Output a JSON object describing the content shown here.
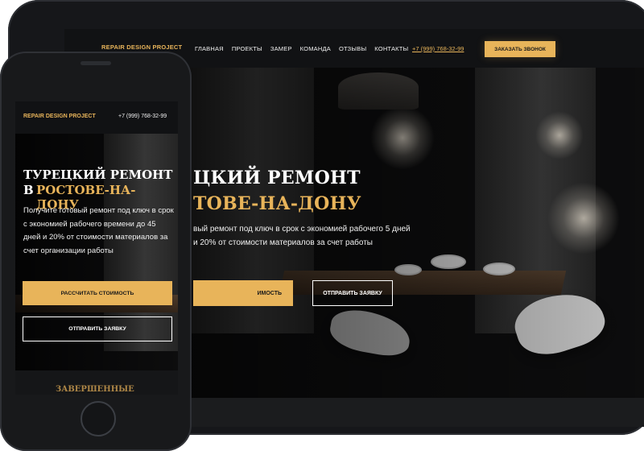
{
  "tablet": {
    "brand": "REPAIR DESIGN PROJECT",
    "nav": {
      "items": [
        "ГЛАВНАЯ",
        "ПРОЕКТЫ",
        "ЗАМЕР",
        "КОМАНДА",
        "ОТЗЫВЫ",
        "КОНТАКТЫ"
      ],
      "phone": "+7 (999) 768-32-99",
      "cta": "ЗАКАЗАТЬ ЗВОНОК"
    },
    "hero": {
      "title_line1": "ЦКИЙ РЕМОНТ",
      "title_line2": "ТОВЕ-НА-ДОНУ",
      "description": "вый ремонт под ключ в срок с экономией рабочего 5 дней и 20% от стоимости материалов за счет работы",
      "button_primary": "ИМОСТЬ",
      "button_secondary": "ОТПРАВИТЬ ЗАЯВКУ"
    }
  },
  "phone": {
    "brand": "REPAIR DESIGN PROJECT",
    "phone": "+7 (999) 768-32-99",
    "hero": {
      "title_line1": "ТУРЕЦКИЙ РЕМОНТ",
      "title_line2_prefix": "В",
      "title_line2_highlight": "РОСТОВЕ-НА-ДОНУ",
      "description": "Получите готовый ремонт под ключ в срок с экономией рабочего времени до 45 дней и 20% от стоимости материалов за счет организации работы",
      "button_primary": "РАССЧИТАТЬ СТОИМОСТЬ",
      "button_secondary": "ОТПРАВИТЬ ЗАЯВКУ"
    },
    "next_section_title_partial": "ЗАВЕРШЕННЫЕ"
  },
  "colors": {
    "accent": "#e8b45a",
    "dark_bg": "#111214",
    "text_light": "#f0f0f0"
  }
}
